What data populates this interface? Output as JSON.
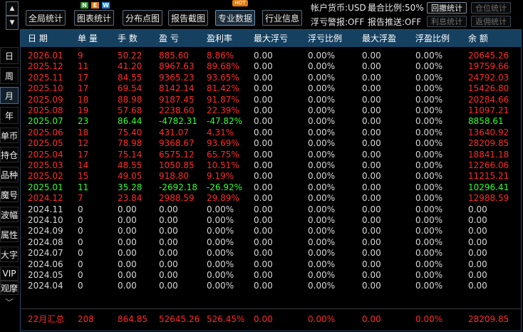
{
  "scroll": {
    "up": "▲",
    "down": "▼"
  },
  "toolbar": {
    "buttons": [
      {
        "label": "全局统计",
        "active": false
      },
      {
        "label": "图表统计",
        "active": false
      },
      {
        "label": "分布点图",
        "active": false
      },
      {
        "label": "报告截图",
        "active": false
      },
      {
        "label": "专业数据",
        "active": true
      },
      {
        "label": "行业信息",
        "active": false
      }
    ],
    "new_badges": [
      "N",
      "E",
      "W"
    ],
    "hot_badge": "HOT"
  },
  "account": {
    "currency": "帐户货币:USD",
    "max_ratio": "最合比例:50%",
    "float_alert": "浮亏警报:OFF",
    "report_push": "报告推送:OFF",
    "buttons": [
      {
        "label": "回撤统计",
        "enabled": true
      },
      {
        "label": "仓位统计",
        "enabled": false
      },
      {
        "label": "利息统计",
        "enabled": false
      },
      {
        "label": "返佣统计",
        "enabled": false
      }
    ]
  },
  "sidebar": {
    "items": [
      "日",
      "周",
      "月",
      "年",
      "单币",
      "持仓",
      "品种",
      "魔号",
      "波幅",
      "属性",
      "大字",
      "VIP",
      "观摩"
    ],
    "active_index": 2,
    "scroll_icon": "﹀"
  },
  "colors": {
    "profit": "#ff2a2a",
    "loss": "#2eff2e",
    "zero": "#d8d8d8",
    "header_bg": "#16405f",
    "summary": "#ff2a2a"
  },
  "table": {
    "columns": [
      "日 期",
      "单 量",
      "手 数",
      "盈 亏",
      "盈利率",
      "最大浮亏",
      "浮亏比例",
      "最大浮盈",
      "浮盈比例",
      "余 额"
    ],
    "rows": [
      {
        "tone": "profit",
        "cells": [
          "2026.01",
          "9",
          "50.22",
          "885.60",
          "8.86%",
          "0.00",
          "0.00%",
          "0.00",
          "0.00%",
          "20645.26"
        ]
      },
      {
        "tone": "profit",
        "cells": [
          "2025.12",
          "11",
          "41.20",
          "8967.63",
          "89.68%",
          "0.00",
          "0.00%",
          "0.00",
          "0.00%",
          "19759.66"
        ]
      },
      {
        "tone": "profit",
        "cells": [
          "2025.11",
          "17",
          "84.55",
          "9365.23",
          "93.65%",
          "0.00",
          "0.00%",
          "0.00",
          "0.00%",
          "24792.03"
        ]
      },
      {
        "tone": "profit",
        "cells": [
          "2025.10",
          "17",
          "69.54",
          "8142.14",
          "81.42%",
          "0.00",
          "0.00%",
          "0.00",
          "0.00%",
          "15426.80"
        ]
      },
      {
        "tone": "profit",
        "cells": [
          "2025.09",
          "18",
          "88.98",
          "9187.45",
          "91.87%",
          "0.00",
          "0.00%",
          "0.00",
          "0.00%",
          "20284.66"
        ]
      },
      {
        "tone": "profit",
        "cells": [
          "2025.08",
          "19",
          "57.68",
          "2238.60",
          "22.39%",
          "0.00",
          "0.00%",
          "0.00",
          "0.00%",
          "11097.21"
        ]
      },
      {
        "tone": "loss",
        "cells": [
          "2025.07",
          "23",
          "86.44",
          "-4782.31",
          "-47.82%",
          "0.00",
          "0.00%",
          "0.00",
          "0.00%",
          "8858.61"
        ]
      },
      {
        "tone": "profit",
        "cells": [
          "2025.06",
          "18",
          "75.40",
          "431.07",
          "4.31%",
          "0.00",
          "0.00%",
          "0.00",
          "0.00%",
          "13640.92"
        ]
      },
      {
        "tone": "profit",
        "cells": [
          "2025.05",
          "12",
          "78.98",
          "9368.67",
          "93.69%",
          "0.00",
          "0.00%",
          "0.00",
          "0.00%",
          "28209.85"
        ]
      },
      {
        "tone": "profit",
        "cells": [
          "2025.04",
          "17",
          "75.14",
          "6575.12",
          "65.75%",
          "0.00",
          "0.00%",
          "0.00",
          "0.00%",
          "18841.18"
        ]
      },
      {
        "tone": "profit",
        "cells": [
          "2025.03",
          "14",
          "48.55",
          "1050.85",
          "10.51%",
          "0.00",
          "0.00%",
          "0.00",
          "0.00%",
          "12266.06"
        ]
      },
      {
        "tone": "profit",
        "cells": [
          "2025.02",
          "15",
          "49.05",
          "918.80",
          "9.19%",
          "0.00",
          "0.00%",
          "0.00",
          "0.00%",
          "11215.21"
        ]
      },
      {
        "tone": "loss",
        "cells": [
          "2025.01",
          "11",
          "35.28",
          "-2692.18",
          "-26.92%",
          "0.00",
          "0.00%",
          "0.00",
          "0.00%",
          "10296.41"
        ]
      },
      {
        "tone": "profit",
        "cells": [
          "2024.12",
          "7",
          "23.84",
          "2988.59",
          "29.89%",
          "0.00",
          "0.00%",
          "0.00",
          "0.00%",
          "12988.59"
        ]
      },
      {
        "tone": "zero",
        "cells": [
          "2024.11",
          "0",
          "0.00",
          "0.00",
          "0.00%",
          "0.00",
          "0.00%",
          "0.00",
          "0.00%",
          "0.00"
        ]
      },
      {
        "tone": "zero",
        "cells": [
          "2024.10",
          "0",
          "0.00",
          "0.00",
          "0.00%",
          "0.00",
          "0.00%",
          "0.00",
          "0.00%",
          "0.00"
        ]
      },
      {
        "tone": "zero",
        "cells": [
          "2024.09",
          "0",
          "0.00",
          "0.00",
          "0.00%",
          "0.00",
          "0.00%",
          "0.00",
          "0.00%",
          "0.00"
        ]
      },
      {
        "tone": "zero",
        "cells": [
          "2024.08",
          "0",
          "0.00",
          "0.00",
          "0.00%",
          "0.00",
          "0.00%",
          "0.00",
          "0.00%",
          "0.00"
        ]
      },
      {
        "tone": "zero",
        "cells": [
          "2024.07",
          "0",
          "0.00",
          "0.00",
          "0.00%",
          "0.00",
          "0.00%",
          "0.00",
          "0.00%",
          "0.00"
        ]
      },
      {
        "tone": "zero",
        "cells": [
          "2024.06",
          "0",
          "0.00",
          "0.00",
          "0.00%",
          "0.00",
          "0.00%",
          "0.00",
          "0.00%",
          "0.00"
        ]
      },
      {
        "tone": "zero",
        "cells": [
          "2024.05",
          "0",
          "0.00",
          "0.00",
          "0.00%",
          "0.00",
          "0.00%",
          "0.00",
          "0.00%",
          "0.00"
        ]
      },
      {
        "tone": "zero",
        "cells": [
          "2024.04",
          "0",
          "0.00",
          "0.00",
          "0.00%",
          "0.00",
          "0.00%",
          "0.00",
          "0.00%",
          "0.00"
        ]
      }
    ],
    "summary": [
      "22月汇总",
      "208",
      "864.85",
      "52645.26",
      "526.45%",
      "0.00",
      "0.00%",
      "0.00",
      "0.00%",
      "28209.85"
    ]
  }
}
